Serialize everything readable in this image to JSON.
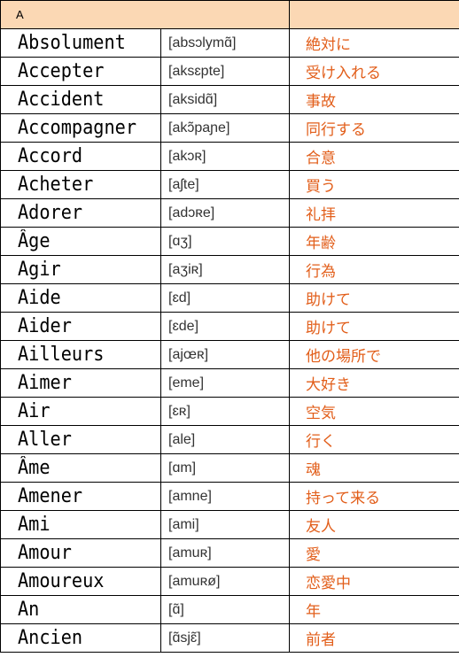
{
  "header": {
    "letter": "A",
    "blank": ""
  },
  "colors": {
    "header_bg": "#fbd8b4",
    "jp_text": "#e25e1a",
    "border": "#000000"
  },
  "rows": [
    {
      "word": "Absolument",
      "ipa": "[absɔlymɑ̃]",
      "jp": "絶対に"
    },
    {
      "word": "Accepter",
      "ipa": "[aksɛpte]",
      "jp": "受け入れる"
    },
    {
      "word": "Accident",
      "ipa": "[aksidɑ̃]",
      "jp": "事故"
    },
    {
      "word": "Accompagner",
      "ipa": "[akɔ̃paɲe]",
      "jp": "同行する"
    },
    {
      "word": "Accord",
      "ipa": "[akɔʀ]",
      "jp": "合意"
    },
    {
      "word": "Acheter",
      "ipa": "[aʃte]",
      "jp": "買う"
    },
    {
      "word": "Adorer",
      "ipa": "[adɔʀe]",
      "jp": "礼拝"
    },
    {
      "word": "Âge",
      "ipa": "[ɑʒ]",
      "jp": "年齢"
    },
    {
      "word": "Agir",
      "ipa": "[aʒiʀ]",
      "jp": "行為"
    },
    {
      "word": "Aide",
      "ipa": "[ɛd]",
      "jp": "助けて"
    },
    {
      "word": "Aider",
      "ipa": "[ɛde]",
      "jp": "助けて"
    },
    {
      "word": "Ailleurs",
      "ipa": "[ajœʀ]",
      "jp": "他の場所で"
    },
    {
      "word": "Aimer",
      "ipa": "[eme]",
      "jp": "大好き"
    },
    {
      "word": "Air",
      "ipa": "[ɛʀ]",
      "jp": "空気"
    },
    {
      "word": "Aller",
      "ipa": "[ale]",
      "jp": "行く"
    },
    {
      "word": "Âme",
      "ipa": "[ɑm]",
      "jp": "魂"
    },
    {
      "word": "Amener",
      "ipa": "[amne]",
      "jp": "持って来る"
    },
    {
      "word": "Ami",
      "ipa": "[ami]",
      "jp": "友人"
    },
    {
      "word": "Amour",
      "ipa": "[amuʀ]",
      "jp": "愛"
    },
    {
      "word": "Amoureux",
      "ipa": "[amuʀø]",
      "jp": "恋愛中"
    },
    {
      "word": "An",
      "ipa": "[ɑ̃]",
      "jp": "年"
    },
    {
      "word": "Ancien",
      "ipa": "[ɑ̃sjɛ̃]",
      "jp": "前者"
    }
  ]
}
